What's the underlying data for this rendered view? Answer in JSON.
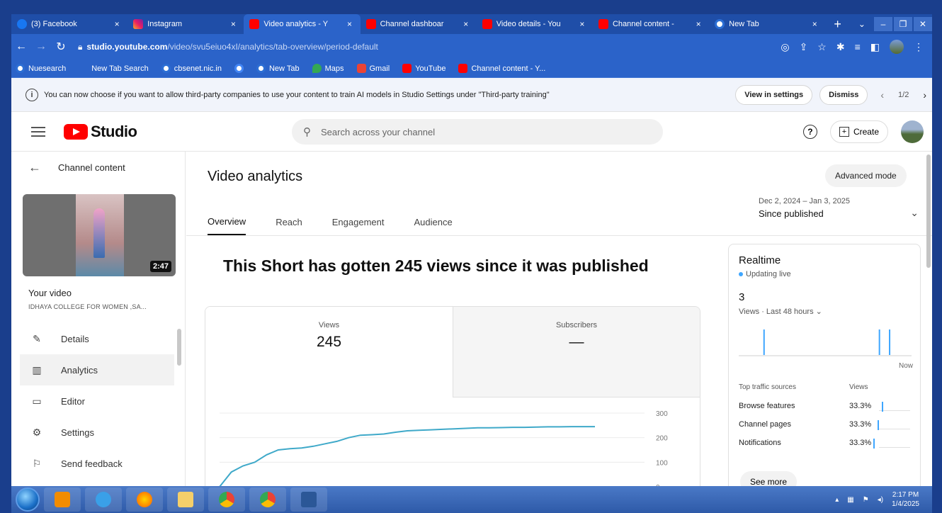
{
  "browser": {
    "tabs": [
      {
        "label": "(3) Facebook",
        "icon": "facebook-icon",
        "active": false
      },
      {
        "label": "Instagram",
        "icon": "instagram-icon",
        "active": false
      },
      {
        "label": "Video analytics - Y",
        "icon": "youtube-icon",
        "active": true
      },
      {
        "label": "Channel dashboar",
        "icon": "youtube-icon",
        "active": false
      },
      {
        "label": "Video details - You",
        "icon": "youtube-icon",
        "active": false
      },
      {
        "label": "Channel content -",
        "icon": "youtube-icon",
        "active": false
      },
      {
        "label": "New Tab",
        "icon": "chrome-icon",
        "active": false
      }
    ],
    "close_glyph": "×",
    "new_tab_glyph": "+",
    "url_host": "studio.youtube.com",
    "url_path": "/video/svu5eiuo4xI/analytics/tab-overview/period-default",
    "bookmarks": [
      {
        "label": "Nuesearch",
        "icon": "search-icon"
      },
      {
        "label": "New Tab Search",
        "icon": "page-icon"
      },
      {
        "label": "cbsenet.nic.in",
        "icon": "chrome-icon"
      },
      {
        "label": "",
        "icon": "google-icon"
      },
      {
        "label": "New Tab",
        "icon": "chrome-icon"
      },
      {
        "label": "Maps",
        "icon": "maps-icon"
      },
      {
        "label": "Gmail",
        "icon": "gmail-icon"
      },
      {
        "label": "YouTube",
        "icon": "youtube-icon"
      },
      {
        "label": "Channel content - Y...",
        "icon": "youtube-icon"
      }
    ]
  },
  "banner": {
    "message": "You can now choose if you want to allow third-party companies to use your content to train AI models in Studio Settings under \"Third-party training\"",
    "view_settings": "View in settings",
    "dismiss": "Dismiss",
    "pager": "1/2"
  },
  "header": {
    "logo_text": "Studio",
    "search_placeholder": "Search across your channel",
    "create_label": "Create"
  },
  "sidebar": {
    "back_label": "Channel content",
    "thumbnail_duration": "2:47",
    "your_video_label": "Your video",
    "video_title": "IDHAYA COLLEGE FOR WOMEN ,SA...",
    "items": [
      {
        "label": "Details",
        "icon": "pencil-icon",
        "active": false
      },
      {
        "label": "Analytics",
        "icon": "analytics-icon",
        "active": true
      },
      {
        "label": "Editor",
        "icon": "editor-icon",
        "active": false
      },
      {
        "label": "Settings",
        "icon": "gear-icon",
        "active": false
      },
      {
        "label": "Send feedback",
        "icon": "feedback-icon",
        "active": false
      }
    ]
  },
  "main": {
    "title": "Video analytics",
    "advanced_mode": "Advanced mode",
    "tabs": [
      "Overview",
      "Reach",
      "Engagement",
      "Audience"
    ],
    "active_tab": "Overview",
    "period_range": "Dec 2, 2024 – Jan 3, 2025",
    "period_label": "Since published",
    "headline": "This Short has gotten 245 views since it was published",
    "metrics": {
      "views_label": "Views",
      "views_value": "245",
      "subs_label": "Subscribers",
      "subs_value": "—"
    }
  },
  "chart_data": {
    "type": "line",
    "x": [
      0,
      1,
      2,
      3,
      4,
      5,
      6,
      7,
      8,
      9,
      10,
      11,
      12,
      13,
      14,
      15,
      16,
      17,
      18,
      19,
      20,
      21,
      22,
      23,
      24,
      25,
      26,
      27,
      28,
      29,
      30,
      31,
      32
    ],
    "values": [
      0,
      60,
      85,
      100,
      130,
      150,
      155,
      158,
      165,
      175,
      185,
      200,
      210,
      212,
      215,
      222,
      228,
      230,
      232,
      234,
      236,
      238,
      240,
      240,
      241,
      242,
      242,
      243,
      244,
      244,
      245,
      245,
      245
    ],
    "y_ticks": [
      "300",
      "200",
      "100",
      "0"
    ],
    "ylim": [
      0,
      300
    ],
    "grid": true,
    "color": "#3fa9c9"
  },
  "realtime": {
    "title": "Realtime",
    "live_label": "Updating live",
    "count": "3",
    "views_label": "Views · Last 48 hours",
    "now_label": "Now",
    "spark_bars": [
      0,
      0,
      0,
      0,
      0,
      0,
      1,
      0,
      0,
      0,
      0,
      0,
      0,
      0,
      0,
      0,
      0,
      0,
      0,
      0,
      0,
      0,
      0,
      0,
      0,
      0,
      0,
      0,
      0,
      0,
      0,
      0,
      0,
      0,
      0,
      0,
      0,
      0,
      0,
      0,
      1,
      0,
      0,
      1,
      0,
      0,
      0,
      0
    ],
    "sources_header": "Top traffic sources",
    "sources_views_header": "Views",
    "sources": [
      {
        "name": "Browse features",
        "pct": "33.3%"
      },
      {
        "name": "Channel pages",
        "pct": "33.3%"
      },
      {
        "name": "Notifications",
        "pct": "33.3%"
      }
    ],
    "see_more": "See more"
  },
  "taskbar": {
    "time": "2:17 PM",
    "date": "1/4/2025"
  },
  "colors": {
    "accent": "#3ea6ff",
    "brand_red": "#ff0000",
    "chrome_blue": "#2b63c9"
  }
}
